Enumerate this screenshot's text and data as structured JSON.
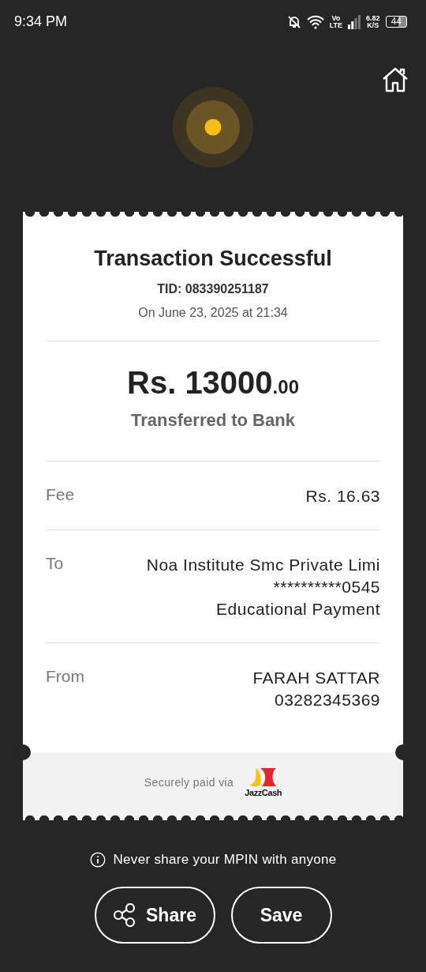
{
  "status_bar": {
    "time": "9:34 PM",
    "network_label": [
      "Vo",
      "LTE"
    ],
    "speed": [
      "6.82",
      "K/S"
    ],
    "battery": "44"
  },
  "receipt": {
    "title": "Transaction Successful",
    "tid": "TID: 083390251187",
    "date": "On June 23, 2025 at 21:34",
    "amount": "Rs. 13000",
    "amount_decimals": ".00",
    "subtitle": "Transferred to Bank",
    "rows": [
      {
        "label": "Fee",
        "lines": [
          "Rs. 16.63"
        ]
      },
      {
        "label": "To",
        "lines": [
          "Noa Institute Smc Private Limi",
          "**********0545",
          "Educational Payment"
        ]
      },
      {
        "label": "From",
        "lines": [
          "FARAH SATTAR",
          "03282345369"
        ]
      }
    ],
    "footer": {
      "text": "Securely paid via",
      "logo_text": "JazzCash"
    }
  },
  "notice": "Never share your MPIN with anyone",
  "buttons": [
    {
      "label": "Share",
      "kind": "share"
    },
    {
      "label": "Save",
      "kind": "plain"
    }
  ]
}
